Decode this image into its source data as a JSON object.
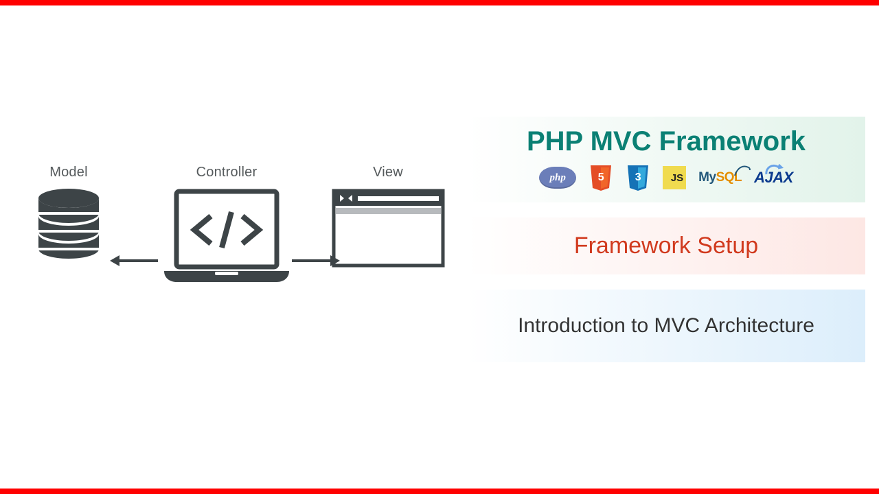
{
  "diagram": {
    "labels": {
      "model": "Model",
      "controller": "Controller",
      "view": "View"
    }
  },
  "panels": {
    "title": "PHP MVC Framework",
    "subtitle": "Framework Setup",
    "topic": "Introduction to MVC Architecture"
  },
  "logos": {
    "php": "php",
    "html5": "5",
    "css3": "3",
    "js": "JS",
    "mysql_my": "My",
    "mysql_sql": "SQL",
    "ajax": "AJAX"
  },
  "colors": {
    "accent_red": "#ff0000",
    "title_teal": "#0b8074",
    "subtitle_red": "#d13a1e"
  }
}
